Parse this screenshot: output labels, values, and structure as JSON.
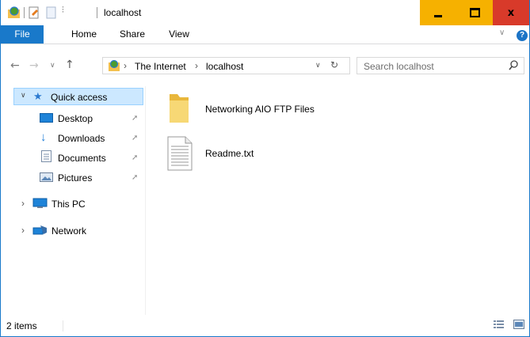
{
  "window": {
    "title": "localhost"
  },
  "quick_access_toolbar": {
    "dropdown_glyph": "⫶"
  },
  "ribbon": {
    "tabs": [
      "File",
      "Home",
      "Share",
      "View"
    ],
    "help_glyph": "?"
  },
  "address": {
    "breadcrumb": [
      "The Internet",
      "localhost"
    ],
    "search_placeholder": "Search localhost"
  },
  "nav": {
    "quick_access": "Quick access",
    "pinned": [
      {
        "label": "Desktop",
        "icon": "desktop-icon"
      },
      {
        "label": "Downloads",
        "icon": "downloads-icon"
      },
      {
        "label": "Documents",
        "icon": "documents-icon"
      },
      {
        "label": "Pictures",
        "icon": "pictures-icon"
      }
    ],
    "this_pc": "This PC",
    "network": "Network"
  },
  "files": [
    {
      "name": "Networking AIO FTP Files",
      "icon": "folder-icon"
    },
    {
      "name": "Readme.txt",
      "icon": "text-file-icon"
    }
  ],
  "status": {
    "item_count": "2 items"
  },
  "colors": {
    "accent": "#1979ca",
    "close": "#d83a2a",
    "min_max": "#f6b100",
    "selection": "#cce8ff"
  }
}
